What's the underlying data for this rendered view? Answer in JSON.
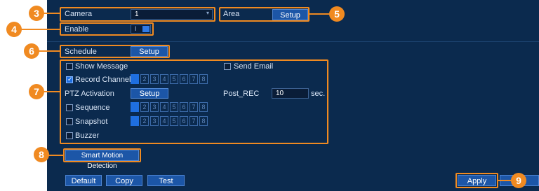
{
  "camera": {
    "label": "Camera",
    "value": "1"
  },
  "area": {
    "label": "Area",
    "button": "Setup"
  },
  "enable": {
    "label": "Enable",
    "value": "I"
  },
  "schedule": {
    "label": "Schedule",
    "button": "Setup"
  },
  "actions": {
    "show_message": "Show Message",
    "send_email": "Send Email",
    "record_channel": "Record Channel",
    "ptz_activation": "PTZ Activation",
    "ptz_button": "Setup",
    "post_rec_label": "Post_REC",
    "post_rec_value": "10",
    "post_rec_unit": "sec.",
    "sequence": "Sequence",
    "snapshot": "Snapshot",
    "buzzer": "Buzzer"
  },
  "channels": [
    "1",
    "2",
    "3",
    "4",
    "5",
    "6",
    "7",
    "8"
  ],
  "smd": {
    "label": "Smart Motion Detection"
  },
  "footer": {
    "default": "Default",
    "copy": "Copy",
    "test": "Test",
    "apply": "Apply"
  },
  "badges": [
    "3",
    "4",
    "5",
    "6",
    "7",
    "8",
    "9"
  ],
  "colors": {
    "accent": "#f08a21",
    "panel": "#0b2a4e",
    "button": "#1c56a7"
  }
}
